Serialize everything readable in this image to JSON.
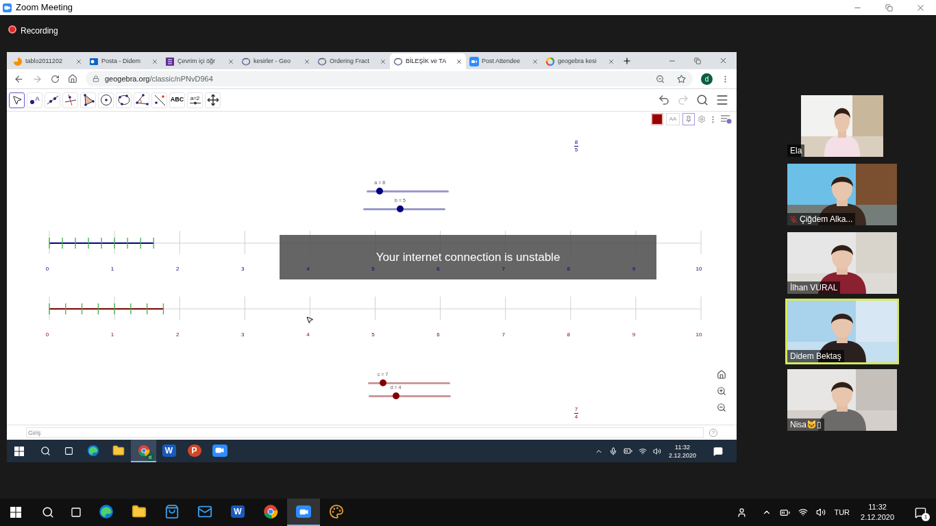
{
  "window": {
    "title": "Zoom Meeting"
  },
  "recording": {
    "label": "Recording"
  },
  "browser": {
    "tabs": [
      {
        "label": "tablo2011202",
        "kind": "pie",
        "selected": false
      },
      {
        "label": "Posta - Didem",
        "kind": "mail",
        "selected": false
      },
      {
        "label": "Çevrim içi öğr",
        "kind": "form",
        "selected": false
      },
      {
        "label": "kesirler - Geo",
        "kind": "geogebra",
        "selected": false
      },
      {
        "label": "Ordering Fract",
        "kind": "geogebra",
        "selected": false
      },
      {
        "label": "BİLEŞİK ve TA",
        "kind": "geogebra",
        "selected": true
      },
      {
        "label": "Post Attendee",
        "kind": "video",
        "selected": false
      },
      {
        "label": "geogebra kesi",
        "kind": "ring",
        "selected": false
      }
    ],
    "address_host": "geogebra.org",
    "address_path": "/classic/nPNvD964",
    "profile": "d"
  },
  "geogebra": {
    "tools": [
      {
        "kind": "move",
        "selected": true
      },
      {
        "kind": "point",
        "label": "A",
        "selected": false
      },
      {
        "kind": "line",
        "selected": false
      },
      {
        "kind": "perpendicular",
        "selected": false
      },
      {
        "kind": "polygon",
        "selected": false
      },
      {
        "kind": "circle",
        "selected": false
      },
      {
        "kind": "conic",
        "selected": false
      },
      {
        "kind": "angle",
        "selected": false
      },
      {
        "kind": "reflect",
        "selected": false
      },
      {
        "kind": "text",
        "label": "ABC",
        "selected": false
      },
      {
        "kind": "slider",
        "label": "a=2",
        "selected": false
      },
      {
        "kind": "pan",
        "selected": false
      }
    ],
    "style_bar": {
      "color": "#990000",
      "font_label": "AA"
    },
    "sliders": [
      {
        "label": "a = 8",
        "level": 0.16,
        "color": "#00007f"
      },
      {
        "label": "b = 5",
        "level": 0.45,
        "color": "#00007f"
      },
      {
        "label": "c = 7",
        "level": 0.18,
        "color": "#800000"
      },
      {
        "label": "d = 4",
        "level": 0.33,
        "color": "#800000"
      }
    ],
    "number_lines": [
      {
        "color": "#00007f",
        "fraction": {
          "numerator": "8",
          "denominator": "5"
        },
        "labels": [
          "0",
          "1",
          "2",
          "3",
          "4",
          "5",
          "6",
          "7",
          "8",
          "9",
          "10"
        ]
      },
      {
        "color": "#800000",
        "fraction": {
          "numerator": "7",
          "denominator": "4"
        },
        "labels": [
          "0",
          "1",
          "2",
          "3",
          "4",
          "5",
          "6",
          "7",
          "8",
          "9",
          "10"
        ]
      }
    ],
    "toast": "Your internet connection is unstable",
    "input": {
      "placeholder": "Giriş",
      "help": "?"
    }
  },
  "shared_taskbar": {
    "apps": [
      {
        "kind": "edge",
        "active": false
      },
      {
        "kind": "folder",
        "active": false
      },
      {
        "kind": "chrome",
        "badge": "d",
        "active": true
      },
      {
        "kind": "word",
        "label": "W",
        "active": false
      },
      {
        "kind": "powerpoint",
        "label": "P",
        "active": false
      },
      {
        "kind": "zoom",
        "active": false
      }
    ],
    "time": "11:32",
    "date": "2.12.2020"
  },
  "participants": [
    {
      "name": "Ela",
      "muted": false,
      "speaking": false
    },
    {
      "name": "Çiğdem Alka...",
      "muted": true,
      "speaking": false
    },
    {
      "name": "İlhan VURAL",
      "muted": false,
      "speaking": false
    },
    {
      "name": "Didem Bektaş",
      "muted": false,
      "speaking": true
    },
    {
      "name": "Nisa🐱▯",
      "muted": false,
      "speaking": false
    }
  ],
  "taskbar": {
    "apps": [
      {
        "kind": "edge",
        "active": false
      },
      {
        "kind": "folder",
        "active": false
      },
      {
        "kind": "store",
        "active": false
      },
      {
        "kind": "mail",
        "active": false
      },
      {
        "kind": "word",
        "label": "W",
        "active": false
      },
      {
        "kind": "chrome",
        "active": false
      },
      {
        "kind": "zoom",
        "active": true
      },
      {
        "kind": "paint",
        "active": false
      }
    ],
    "language": "TUR",
    "time": "11:32",
    "date": "2.12.2020",
    "notifications": "1"
  }
}
